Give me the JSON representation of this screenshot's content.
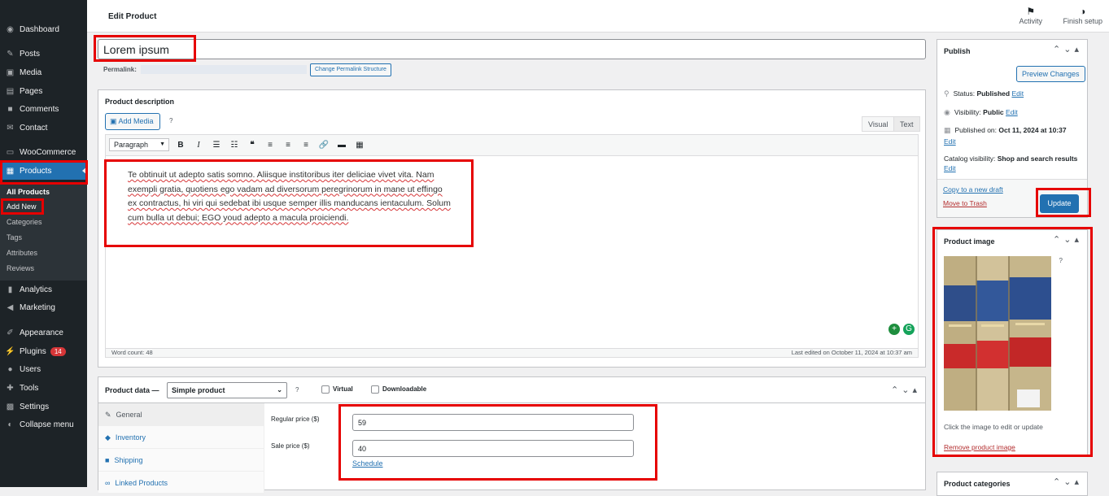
{
  "sidebar": {
    "items": [
      {
        "label": "Dashboard",
        "icon": "dashboard-icon"
      },
      {
        "label": "Posts",
        "icon": "pin-icon"
      },
      {
        "label": "Media",
        "icon": "media-icon"
      },
      {
        "label": "Pages",
        "icon": "page-icon"
      },
      {
        "label": "Comments",
        "icon": "comment-icon"
      },
      {
        "label": "Contact",
        "icon": "mail-icon"
      },
      {
        "label": "WooCommerce",
        "icon": "woo-icon"
      },
      {
        "label": "Products",
        "icon": "archive-icon"
      },
      {
        "label": "Analytics",
        "icon": "chart-icon"
      },
      {
        "label": "Marketing",
        "icon": "megaphone-icon"
      },
      {
        "label": "Appearance",
        "icon": "brush-icon"
      },
      {
        "label": "Plugins",
        "icon": "plugin-icon",
        "badge": "14"
      },
      {
        "label": "Users",
        "icon": "user-icon"
      },
      {
        "label": "Tools",
        "icon": "wrench-icon"
      },
      {
        "label": "Settings",
        "icon": "settings-icon"
      },
      {
        "label": "Collapse menu",
        "icon": "collapse-icon"
      }
    ],
    "submenu": [
      "All Products",
      "Add New",
      "Categories",
      "Tags",
      "Attributes",
      "Reviews"
    ]
  },
  "topbar": {
    "title": "Edit Product",
    "activity": "Activity",
    "finish_setup": "Finish setup"
  },
  "title_field": {
    "value": "Lorem ipsum"
  },
  "permalink": {
    "label": "Permalink:",
    "button": "Change Permalink Structure"
  },
  "description": {
    "title": "Product description",
    "add_media": "Add Media",
    "help": "?",
    "tab_visual": "Visual",
    "tab_text": "Text",
    "format": "Paragraph",
    "content": "Te obtinuit ut adepto satis somno. Aliisque institoribus iter deliciae vivet vita. Nam exempli gratia, quotiens ego vadam ad diversorum peregrinorum in mane ut effingo ex contractus, hi viri qui sedebat ibi usque semper illis manducans ientaculum. Solum cum bulla ut debui; EGO youd adepto a macula proiciendi.",
    "word_count": "Word count: 48",
    "last_edited": "Last edited on October 11, 2024 at 10:37 am"
  },
  "product_data": {
    "title": "Product data —",
    "type": "Simple product",
    "help": "?",
    "virtual": "Virtual",
    "downloadable": "Downloadable",
    "tabs": [
      "General",
      "Inventory",
      "Shipping",
      "Linked Products"
    ],
    "regular_price_label": "Regular price ($)",
    "regular_price": "59",
    "sale_price_label": "Sale price ($)",
    "sale_price": "40",
    "schedule": "Schedule"
  },
  "publish": {
    "title": "Publish",
    "preview": "Preview Changes",
    "status_label": "Status:",
    "status": "Published",
    "visibility_label": "Visibility:",
    "visibility": "Public",
    "published_label": "Published on:",
    "published": "Oct 11, 2024 at 10:37",
    "catalog_label": "Catalog visibility:",
    "catalog": "Shop and search results",
    "edit": "Edit",
    "draft": "Copy to a new draft",
    "trash": "Move to Trash",
    "update": "Update"
  },
  "product_image": {
    "title": "Product image",
    "help": "?",
    "hint": "Click the image to edit or update",
    "remove": "Remove product image"
  },
  "categories": {
    "title": "Product categories"
  },
  "colors": {
    "accent": "#2271b1",
    "sidebar": "#1d2327",
    "highlight": "#e60000"
  }
}
